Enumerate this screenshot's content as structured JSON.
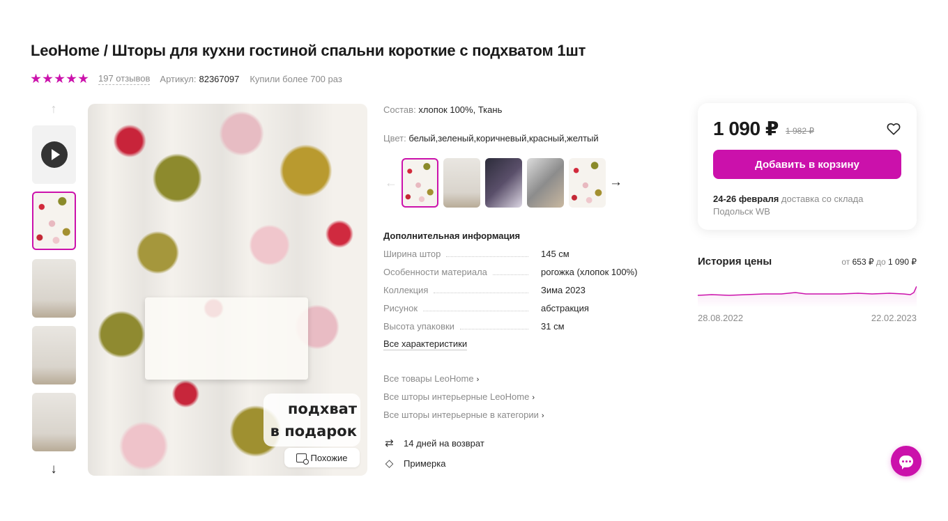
{
  "product": {
    "title": "LeoHome / Шторы для кухни гостиной спальни короткие с подхватом 1шт",
    "rating": 5,
    "reviews": "197 отзывов",
    "article_label": "Артикул:",
    "article_value": "82367097",
    "bought": "Купили более 700 раз"
  },
  "gallery": {
    "thumbs": [
      "video",
      "main",
      "room",
      "room-2",
      "room-3"
    ],
    "active_index": 1,
    "promo_line1": "подхват",
    "promo_line2": "в подарок",
    "similar_label": "Похожие"
  },
  "details": {
    "composition_label": "Состав:",
    "composition_value": "хлопок 100%, Ткань",
    "color_label": "Цвет:",
    "color_value": "белый,зеленый,коричневый,красный,желтый",
    "color_variants_count": 5,
    "active_color_index": 0,
    "additional_title": "Дополнительная информация",
    "specs": [
      {
        "name": "Ширина штор",
        "value": "145 см"
      },
      {
        "name": "Особенности материала",
        "value": "рогожка (хлопок 100%)"
      },
      {
        "name": "Коллекция",
        "value": "Зима 2023"
      },
      {
        "name": "Рисунок",
        "value": "абстракция"
      },
      {
        "name": "Высота упаковки",
        "value": "31 см"
      }
    ],
    "all_characteristics": "Все характеристики",
    "links": [
      "Все товары LeoHome",
      "Все шторы интерьерные LeoHome",
      "Все шторы интерьерные в категории"
    ],
    "perks": [
      {
        "icon": "return-arrows-icon",
        "label": "14 дней на возврат"
      },
      {
        "icon": "tag-icon",
        "label": "Примерка"
      }
    ]
  },
  "buy_card": {
    "price": "1 090 ₽",
    "old_price": "1 982 ₽",
    "cart_button": "Добавить в корзину",
    "delivery_date": "24-26 февраля",
    "delivery_text": " доставка со склада Подольск WB"
  },
  "price_history": {
    "title": "История цены",
    "from_label": "от",
    "min_price": "653 ₽",
    "to_label": "до",
    "max_price": "1 090 ₽",
    "start_date": "28.08.2022",
    "end_date": "22.02.2023"
  },
  "colors": {
    "accent": "#cb11ab",
    "text": "#242424",
    "muted": "#8b8b8b"
  }
}
